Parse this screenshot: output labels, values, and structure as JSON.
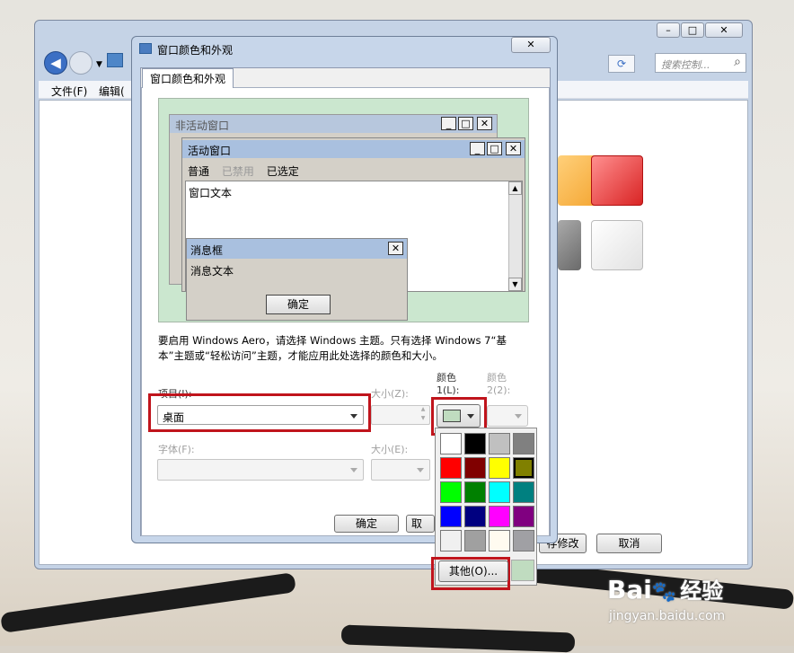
{
  "back_window": {
    "search_placeholder": "搜索控制...",
    "menu": [
      "文件(F)",
      "编辑("
    ],
    "ok_button_partial": "存修改",
    "cancel_button": "取消"
  },
  "dialog": {
    "title": "窗口颜色和外观",
    "tab_label": "窗口颜色和外观",
    "preview": {
      "inactive_title": "非活动窗口",
      "active_title": "活动窗口",
      "menu_items": [
        "普通",
        "已禁用",
        "已选定"
      ],
      "window_text": "窗口文本",
      "msgbox_title": "消息框",
      "msgbox_text": "消息文本",
      "msgbox_ok": "确定"
    },
    "info_text_line1": "要启用 Windows Aero，请选择 Windows 主题。只有选择 Windows 7“基",
    "info_text_line2": "本”主题或“轻松访问”主题，才能应用此处选择的颜色和大小。",
    "labels": {
      "item": "项目(I):",
      "size_z": "大小(Z):",
      "color1_a": "颜色",
      "color1_b": "1(L):",
      "color2_a": "颜色",
      "color2_b": "2(2):",
      "font": "字体(F):",
      "size_e": "大小(E):"
    },
    "item_value": "桌面",
    "ok_button": "确定",
    "cancel_partial": "取"
  },
  "palette": {
    "colors": [
      "#ffffff",
      "#000000",
      "#c0c0c0",
      "#808080",
      "#ff0000",
      "#800000",
      "#ffff00",
      "#808000",
      "#00ff00",
      "#008000",
      "#00ffff",
      "#008080",
      "#0000ff",
      "#000080",
      "#ff00ff",
      "#800080",
      "#f0f0f0",
      "#a0a0a0",
      "#fffbf0",
      "#a0a0a4"
    ],
    "selected_color": "#808000",
    "current_color": "#c0dcc0",
    "other_button": "其他(O)..."
  },
  "watermark": {
    "brand": "Bai",
    "brand_cn": "经验",
    "url": "jingyan.baidu.com"
  }
}
